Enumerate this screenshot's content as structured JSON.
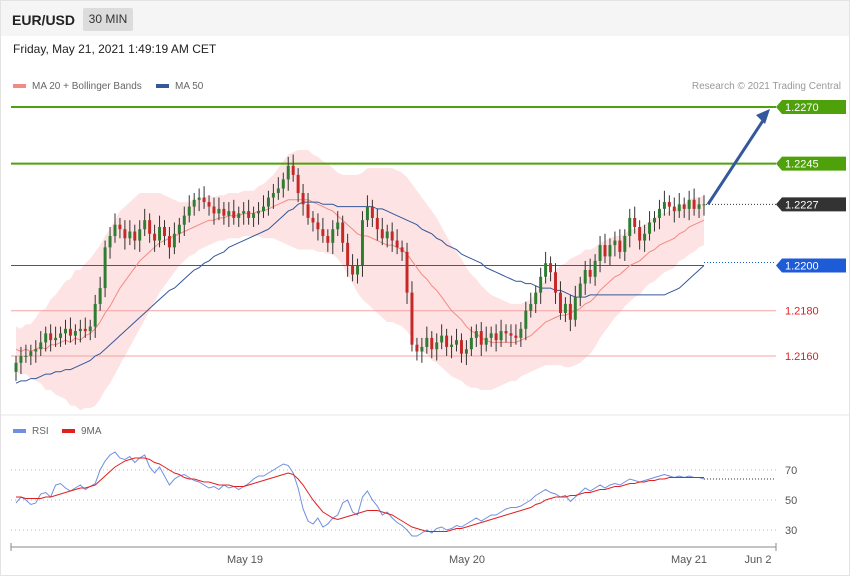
{
  "header": {
    "symbol": "EUR/USD",
    "timeframe": "30 MIN"
  },
  "datetime": "Friday, May 21, 2021 1:49:19 AM CET",
  "legend": {
    "ma20": {
      "label": "MA 20 + Bollinger Bands",
      "color": "#f28b82"
    },
    "ma50": {
      "label": "MA 50",
      "color": "#34589a"
    }
  },
  "credit": "Research © 2021 Trading Central",
  "rsi_legend": {
    "rsi": {
      "label": "RSI",
      "color": "#6f8fe0"
    },
    "ma9": {
      "label": "9MA",
      "color": "#e02020"
    }
  },
  "chart_data": [
    {
      "type": "candlestick",
      "ylim": [
        2.213,
        2.2302
      ],
      "levels": [
        {
          "value": 1.227,
          "label": "1.2270",
          "style": "resistance",
          "color": "#4ea10a"
        },
        {
          "value": 1.2245,
          "label": "1.2245",
          "style": "resistance",
          "color": "#4ea10a"
        },
        {
          "value": 1.2227,
          "label": "1.2227",
          "style": "last",
          "color": "#333333"
        },
        {
          "value": 1.22,
          "label": "1.2200",
          "style": "pivot",
          "color": "#1e5bd6"
        },
        {
          "value": 1.218,
          "label": "1.2180",
          "style": "support",
          "color": "#e02020"
        },
        {
          "value": 1.216,
          "label": "1.2160",
          "style": "support",
          "color": "#e02020"
        }
      ],
      "projection": {
        "from": 1.2227,
        "to": 1.227,
        "color": "#34589a"
      },
      "x_ticks": [
        "May 19",
        "May 20",
        "May 21",
        "Jun 2"
      ],
      "close": [
        1.2157,
        1.216,
        1.216,
        1.2162,
        1.2163,
        1.2166,
        1.217,
        1.2167,
        1.2168,
        1.217,
        1.2172,
        1.2169,
        1.2171,
        1.2172,
        1.2171,
        1.2173,
        1.2183,
        1.219,
        1.2208,
        1.2213,
        1.2218,
        1.2216,
        1.2212,
        1.2215,
        1.2211,
        1.2216,
        1.222,
        1.2214,
        1.2211,
        1.2217,
        1.2213,
        1.2208,
        1.2214,
        1.2218,
        1.2222,
        1.2226,
        1.2229,
        1.223,
        1.2228,
        1.2226,
        1.2223,
        1.2225,
        1.2222,
        1.2224,
        1.2221,
        1.2223,
        1.2224,
        1.2221,
        1.2223,
        1.2224,
        1.2226,
        1.223,
        1.2232,
        1.2234,
        1.2238,
        1.2244,
        1.224,
        1.2232,
        1.2227,
        1.2221,
        1.2219,
        1.2216,
        1.2213,
        1.221,
        1.2216,
        1.2219,
        1.221,
        1.22,
        1.2196,
        1.22,
        1.222,
        1.2226,
        1.2221,
        1.2216,
        1.2212,
        1.2215,
        1.2211,
        1.2208,
        1.2206,
        1.2188,
        1.2165,
        1.2162,
        1.2164,
        1.2168,
        1.2163,
        1.2166,
        1.2169,
        1.2164,
        1.2165,
        1.2167,
        1.2161,
        1.2163,
        1.2168,
        1.2171,
        1.2165,
        1.2168,
        1.217,
        1.2167,
        1.2171,
        1.217,
        1.2169,
        1.2168,
        1.2172,
        1.218,
        1.2183,
        1.2188,
        1.2195,
        1.2201,
        1.2197,
        1.2188,
        1.2179,
        1.2183,
        1.2176,
        1.2186,
        1.2192,
        1.2198,
        1.2195,
        1.2202,
        1.2209,
        1.2204,
        1.2209,
        1.2211,
        1.2206,
        1.2213,
        1.2221,
        1.2217,
        1.2211,
        1.2214,
        1.2219,
        1.2221,
        1.2225,
        1.2228,
        1.2226,
        1.2224,
        1.2227,
        1.2225,
        1.2229,
        1.2225,
        1.2227,
        1.2227
      ],
      "open_first": 1.2153,
      "sma20": [
        1.2163,
        1.2162,
        1.2163,
        1.2162,
        1.2163,
        1.2164,
        1.2163,
        1.2165,
        1.2165,
        1.2166,
        1.2167,
        1.2166,
        1.2168,
        1.2167,
        1.2169,
        1.217,
        1.2172,
        1.2175,
        1.2179,
        1.2182,
        1.2186,
        1.219,
        1.2193,
        1.2196,
        1.2199,
        1.2202,
        1.2204,
        1.2206,
        1.2208,
        1.221,
        1.2211,
        1.2212,
        1.2213,
        1.2214,
        1.2215,
        1.2216,
        1.2217,
        1.2218,
        1.2219,
        1.222,
        1.222,
        1.2221,
        1.2221,
        1.2222,
        1.2222,
        1.2222,
        1.2223,
        1.2223,
        1.2223,
        1.2224,
        1.2224,
        1.2225,
        1.2226,
        1.2227,
        1.2228,
        1.2229,
        1.2229,
        1.2229,
        1.2229,
        1.2229,
        1.2228,
        1.2227,
        1.2226,
        1.2225,
        1.2224,
        1.2222,
        1.222,
        1.2218,
        1.2216,
        1.2214,
        1.2213,
        1.2213,
        1.2212,
        1.2211,
        1.221,
        1.2209,
        1.2209,
        1.2208,
        1.2207,
        1.2205,
        1.2202,
        1.2199,
        1.2196,
        1.2194,
        1.2191,
        1.2189,
        1.2186,
        1.2183,
        1.218,
        1.2178,
        1.2176,
        1.2173,
        1.2171,
        1.217,
        1.2168,
        1.2167,
        1.2166,
        1.2166,
        1.2166,
        1.2166,
        1.2166,
        1.2166,
        1.2167,
        1.2168,
        1.2169,
        1.2171,
        1.2173,
        1.2175,
        1.2176,
        1.2177,
        1.2178,
        1.2178,
        1.2179,
        1.218,
        1.2181,
        1.2183,
        1.2184,
        1.2186,
        1.2189,
        1.2191,
        1.2193,
        1.2195,
        1.2196,
        1.2198,
        1.22,
        1.2201,
        1.2202,
        1.2204,
        1.2206,
        1.2207,
        1.2209,
        1.221,
        1.2211,
        1.2212,
        1.2214,
        1.2215,
        1.2217,
        1.2218,
        1.2219,
        1.222
      ],
      "sma50": [
        1.2148,
        1.2149,
        1.2149,
        1.215,
        1.215,
        1.2151,
        1.2152,
        1.2152,
        1.2153,
        1.2153,
        1.2154,
        1.2154,
        1.2155,
        1.2156,
        1.2157,
        1.2158,
        1.216,
        1.2161,
        1.2163,
        1.2165,
        1.2167,
        1.2169,
        1.2171,
        1.2173,
        1.2175,
        1.2177,
        1.2179,
        1.2181,
        1.2183,
        1.2185,
        1.2187,
        1.2189,
        1.219,
        1.2192,
        1.2194,
        1.2196,
        1.2198,
        1.2199,
        1.2201,
        1.2202,
        1.2204,
        1.2205,
        1.2206,
        1.2208,
        1.2209,
        1.221,
        1.2211,
        1.2212,
        1.2213,
        1.2214,
        1.2215,
        1.2216,
        1.2218,
        1.222,
        1.2222,
        1.2224,
        1.2225,
        1.2227,
        1.2228,
        1.2228,
        1.2228,
        1.2228,
        1.2227,
        1.2227,
        1.2227,
        1.2226,
        1.2226,
        1.2226,
        1.2226,
        1.2226,
        1.2226,
        1.2226,
        1.2226,
        1.2225,
        1.2225,
        1.2224,
        1.2223,
        1.2222,
        1.2221,
        1.222,
        1.2219,
        1.2218,
        1.2216,
        1.2215,
        1.2214,
        1.2212,
        1.2211,
        1.2209,
        1.2208,
        1.2207,
        1.2205,
        1.2204,
        1.2203,
        1.2202,
        1.2201,
        1.2199,
        1.2198,
        1.2197,
        1.2196,
        1.2195,
        1.2194,
        1.2193,
        1.2193,
        1.2192,
        1.2192,
        1.2191,
        1.219,
        1.219,
        1.219,
        1.2189,
        1.2189,
        1.2188,
        1.2187,
        1.2186,
        1.2186,
        1.2186,
        1.2187,
        1.2187,
        1.2187,
        1.2187,
        1.2187,
        1.2187,
        1.2187,
        1.2187,
        1.2187,
        1.2187,
        1.2187,
        1.2187,
        1.2187,
        1.2187,
        1.2187,
        1.2187,
        1.2188,
        1.2189,
        1.219,
        1.2192,
        1.2194,
        1.2196,
        1.2198,
        1.22
      ],
      "bb_half_width": [
        0.001,
        0.001,
        0.0011,
        0.0012,
        0.0014,
        0.0016,
        0.0018,
        0.002,
        0.0022,
        0.0024,
        0.0026,
        0.0028,
        0.003,
        0.0031,
        0.0032,
        0.0033,
        0.0034,
        0.0034,
        0.0034,
        0.0034,
        0.0034,
        0.0034,
        0.0033,
        0.0032,
        0.0031,
        0.003,
        0.0028,
        0.0026,
        0.0024,
        0.0022,
        0.002,
        0.0018,
        0.0016,
        0.0014,
        0.0013,
        0.0012,
        0.0012,
        0.0011,
        0.0011,
        0.0011,
        0.001,
        0.001,
        0.001,
        0.001,
        0.001,
        0.001,
        0.001,
        0.001,
        0.001,
        0.0011,
        0.0012,
        0.0013,
        0.0014,
        0.0016,
        0.0018,
        0.002,
        0.0021,
        0.0022,
        0.0022,
        0.0022,
        0.0021,
        0.0021,
        0.002,
        0.002,
        0.0019,
        0.0019,
        0.002,
        0.0022,
        0.0024,
        0.0026,
        0.0028,
        0.003,
        0.0031,
        0.0032,
        0.0033,
        0.0034,
        0.0034,
        0.0034,
        0.0034,
        0.0034,
        0.0034,
        0.0034,
        0.0034,
        0.0033,
        0.0033,
        0.0032,
        0.0031,
        0.003,
        0.0029,
        0.0028,
        0.0027,
        0.0026,
        0.0025,
        0.0024,
        0.0023,
        0.0022,
        0.0021,
        0.002,
        0.0019,
        0.0018,
        0.0017,
        0.0017,
        0.0016,
        0.0016,
        0.0016,
        0.0017,
        0.0018,
        0.0019,
        0.002,
        0.0021,
        0.0022,
        0.0023,
        0.0024,
        0.0024,
        0.0024,
        0.0024,
        0.0023,
        0.0022,
        0.0021,
        0.002,
        0.0019,
        0.0018,
        0.0017,
        0.0016,
        0.0016,
        0.0015,
        0.0015,
        0.0014,
        0.0014,
        0.0014,
        0.0014,
        0.0013,
        0.0013,
        0.0013,
        0.0012,
        0.0012,
        0.0012,
        0.0012,
        0.0011,
        0.0011
      ]
    },
    {
      "type": "line",
      "ylim": [
        17,
        88
      ],
      "y_ticks": [
        70,
        50,
        30
      ],
      "x_ticks": [
        "May 19",
        "May 20",
        "May 21",
        "Jun 2"
      ],
      "series": [
        {
          "name": "RSI",
          "color": "#6f8fe0",
          "values": [
            48,
            52,
            50,
            47,
            48,
            54,
            55,
            52,
            60,
            61,
            58,
            56,
            58,
            60,
            57,
            59,
            61,
            70,
            76,
            80,
            82,
            78,
            77,
            79,
            75,
            78,
            80,
            72,
            68,
            72,
            66,
            60,
            64,
            66,
            67,
            65,
            63,
            62,
            60,
            58,
            59,
            57,
            60,
            58,
            59,
            57,
            59,
            61,
            64,
            66,
            66,
            68,
            70,
            72,
            74,
            73,
            68,
            58,
            44,
            36,
            34,
            38,
            32,
            34,
            38,
            40,
            48,
            50,
            42,
            40,
            52,
            56,
            50,
            46,
            40,
            42,
            38,
            35,
            33,
            30,
            26,
            26,
            28,
            30,
            28,
            31,
            32,
            30,
            31,
            33,
            32,
            34,
            36,
            38,
            36,
            38,
            40,
            40,
            42,
            44,
            45,
            45,
            46,
            48,
            50,
            53,
            55,
            57,
            55,
            54,
            52,
            53,
            49,
            52,
            55,
            58,
            56,
            58,
            60,
            58,
            60,
            61,
            60,
            62,
            64,
            63,
            62,
            63,
            64,
            65,
            66,
            67,
            66,
            65,
            66,
            65,
            66,
            65,
            65,
            64
          ]
        },
        {
          "name": "9MA",
          "color": "#e02020",
          "values": [
            52,
            52,
            51,
            51,
            51,
            51,
            52,
            52,
            53,
            54,
            55,
            56,
            57,
            58,
            58,
            59,
            60,
            63,
            66,
            69,
            72,
            74,
            76,
            77,
            78,
            78,
            78,
            77,
            75,
            74,
            72,
            70,
            68,
            67,
            65,
            64,
            64,
            63,
            62,
            62,
            61,
            60,
            60,
            60,
            59,
            59,
            59,
            60,
            61,
            62,
            63,
            64,
            65,
            66,
            67,
            68,
            67,
            64,
            60,
            55,
            50,
            46,
            42,
            40,
            38,
            37,
            38,
            39,
            40,
            41,
            42,
            43,
            43,
            43,
            42,
            41,
            40,
            38,
            36,
            34,
            32,
            31,
            30,
            29,
            29,
            29,
            29,
            29,
            30,
            31,
            31,
            32,
            33,
            34,
            35,
            36,
            37,
            38,
            39,
            40,
            41,
            42,
            43,
            44,
            45,
            47,
            48,
            50,
            51,
            52,
            52,
            52,
            53,
            53,
            54,
            55,
            55,
            56,
            57,
            57,
            58,
            59,
            59,
            60,
            61,
            61,
            62,
            62,
            63,
            63,
            64,
            64,
            65,
            65,
            65,
            65,
            65,
            65,
            65,
            65
          ]
        }
      ]
    }
  ]
}
